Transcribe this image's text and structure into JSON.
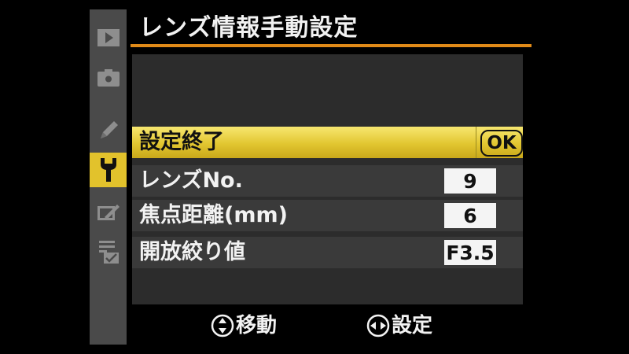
{
  "sidebar": {
    "items": [
      {
        "icon": "playback-icon",
        "active": false
      },
      {
        "icon": "shooting-menu-icon",
        "active": false
      },
      {
        "icon": "pencil-custom-settings-icon",
        "active": false
      },
      {
        "icon": "wrench-setup-icon",
        "active": true
      },
      {
        "icon": "retouch-icon",
        "active": false
      },
      {
        "icon": "my-menu-icon",
        "active": false
      }
    ]
  },
  "header": {
    "title": "レンズ情報手動設定"
  },
  "menu": {
    "done": {
      "label": "設定終了",
      "button": "OK"
    },
    "lens_number": {
      "label": "レンズNo.",
      "value": "9"
    },
    "focal_length": {
      "label": "焦点距離(mm)",
      "value": "6"
    },
    "max_aperture": {
      "label": "開放絞り値",
      "value": "F3.5"
    }
  },
  "footer": {
    "move_label": "移動",
    "set_label": "設定"
  },
  "colors": {
    "accent": "#e08a18",
    "selection": "#e2c630",
    "active_tab": "#e2c22c"
  }
}
